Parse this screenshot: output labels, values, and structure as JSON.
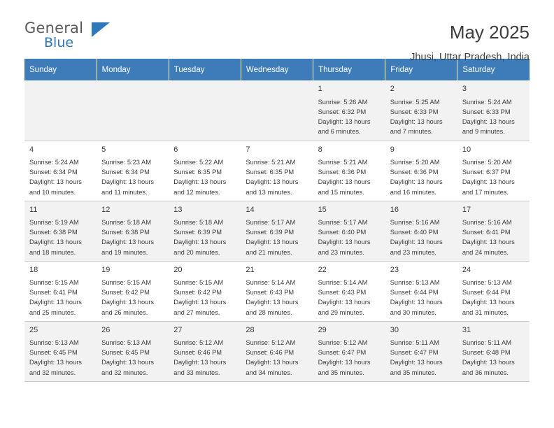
{
  "logo": {
    "word_general": "General",
    "word_blue": "Blue",
    "mark": "triangle-flag"
  },
  "header": {
    "title": "May 2025",
    "location": "Jhusi, Uttar Pradesh, India"
  },
  "calendar": {
    "weekday_headers": [
      "Sunday",
      "Monday",
      "Tuesday",
      "Wednesday",
      "Thursday",
      "Friday",
      "Saturday"
    ],
    "accent_color": "#3d7cb8",
    "weeks": [
      [
        {
          "day": "",
          "info": ""
        },
        {
          "day": "",
          "info": ""
        },
        {
          "day": "",
          "info": ""
        },
        {
          "day": "",
          "info": ""
        },
        {
          "day": "1",
          "info": "Sunrise: 5:26 AM\nSunset: 6:32 PM\nDaylight: 13 hours\nand 6 minutes."
        },
        {
          "day": "2",
          "info": "Sunrise: 5:25 AM\nSunset: 6:33 PM\nDaylight: 13 hours\nand 7 minutes."
        },
        {
          "day": "3",
          "info": "Sunrise: 5:24 AM\nSunset: 6:33 PM\nDaylight: 13 hours\nand 9 minutes."
        }
      ],
      [
        {
          "day": "4",
          "info": "Sunrise: 5:24 AM\nSunset: 6:34 PM\nDaylight: 13 hours\nand 10 minutes."
        },
        {
          "day": "5",
          "info": "Sunrise: 5:23 AM\nSunset: 6:34 PM\nDaylight: 13 hours\nand 11 minutes."
        },
        {
          "day": "6",
          "info": "Sunrise: 5:22 AM\nSunset: 6:35 PM\nDaylight: 13 hours\nand 12 minutes."
        },
        {
          "day": "7",
          "info": "Sunrise: 5:21 AM\nSunset: 6:35 PM\nDaylight: 13 hours\nand 13 minutes."
        },
        {
          "day": "8",
          "info": "Sunrise: 5:21 AM\nSunset: 6:36 PM\nDaylight: 13 hours\nand 15 minutes."
        },
        {
          "day": "9",
          "info": "Sunrise: 5:20 AM\nSunset: 6:36 PM\nDaylight: 13 hours\nand 16 minutes."
        },
        {
          "day": "10",
          "info": "Sunrise: 5:20 AM\nSunset: 6:37 PM\nDaylight: 13 hours\nand 17 minutes."
        }
      ],
      [
        {
          "day": "11",
          "info": "Sunrise: 5:19 AM\nSunset: 6:38 PM\nDaylight: 13 hours\nand 18 minutes."
        },
        {
          "day": "12",
          "info": "Sunrise: 5:18 AM\nSunset: 6:38 PM\nDaylight: 13 hours\nand 19 minutes."
        },
        {
          "day": "13",
          "info": "Sunrise: 5:18 AM\nSunset: 6:39 PM\nDaylight: 13 hours\nand 20 minutes."
        },
        {
          "day": "14",
          "info": "Sunrise: 5:17 AM\nSunset: 6:39 PM\nDaylight: 13 hours\nand 21 minutes."
        },
        {
          "day": "15",
          "info": "Sunrise: 5:17 AM\nSunset: 6:40 PM\nDaylight: 13 hours\nand 23 minutes."
        },
        {
          "day": "16",
          "info": "Sunrise: 5:16 AM\nSunset: 6:40 PM\nDaylight: 13 hours\nand 23 minutes."
        },
        {
          "day": "17",
          "info": "Sunrise: 5:16 AM\nSunset: 6:41 PM\nDaylight: 13 hours\nand 24 minutes."
        }
      ],
      [
        {
          "day": "18",
          "info": "Sunrise: 5:15 AM\nSunset: 6:41 PM\nDaylight: 13 hours\nand 25 minutes."
        },
        {
          "day": "19",
          "info": "Sunrise: 5:15 AM\nSunset: 6:42 PM\nDaylight: 13 hours\nand 26 minutes."
        },
        {
          "day": "20",
          "info": "Sunrise: 5:15 AM\nSunset: 6:42 PM\nDaylight: 13 hours\nand 27 minutes."
        },
        {
          "day": "21",
          "info": "Sunrise: 5:14 AM\nSunset: 6:43 PM\nDaylight: 13 hours\nand 28 minutes."
        },
        {
          "day": "22",
          "info": "Sunrise: 5:14 AM\nSunset: 6:43 PM\nDaylight: 13 hours\nand 29 minutes."
        },
        {
          "day": "23",
          "info": "Sunrise: 5:13 AM\nSunset: 6:44 PM\nDaylight: 13 hours\nand 30 minutes."
        },
        {
          "day": "24",
          "info": "Sunrise: 5:13 AM\nSunset: 6:44 PM\nDaylight: 13 hours\nand 31 minutes."
        }
      ],
      [
        {
          "day": "25",
          "info": "Sunrise: 5:13 AM\nSunset: 6:45 PM\nDaylight: 13 hours\nand 32 minutes."
        },
        {
          "day": "26",
          "info": "Sunrise: 5:13 AM\nSunset: 6:45 PM\nDaylight: 13 hours\nand 32 minutes."
        },
        {
          "day": "27",
          "info": "Sunrise: 5:12 AM\nSunset: 6:46 PM\nDaylight: 13 hours\nand 33 minutes."
        },
        {
          "day": "28",
          "info": "Sunrise: 5:12 AM\nSunset: 6:46 PM\nDaylight: 13 hours\nand 34 minutes."
        },
        {
          "day": "29",
          "info": "Sunrise: 5:12 AM\nSunset: 6:47 PM\nDaylight: 13 hours\nand 35 minutes."
        },
        {
          "day": "30",
          "info": "Sunrise: 5:11 AM\nSunset: 6:47 PM\nDaylight: 13 hours\nand 35 minutes."
        },
        {
          "day": "31",
          "info": "Sunrise: 5:11 AM\nSunset: 6:48 PM\nDaylight: 13 hours\nand 36 minutes."
        }
      ]
    ]
  }
}
